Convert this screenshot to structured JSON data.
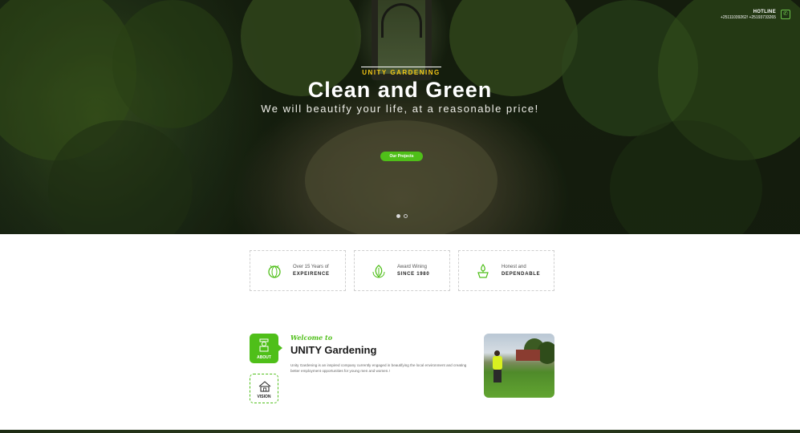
{
  "hero": {
    "kicker": "UNITY GARDENING",
    "title": "Clean and Green",
    "subtitle": "We will beautify your life, at a reasonable price!",
    "cta_label": "Our Projects",
    "slides": 2,
    "active_slide": 1
  },
  "hotline": {
    "label": "HOTLINE",
    "numbers": "+25111039262! +25193733265"
  },
  "features": [
    {
      "icon": "cabbage-icon",
      "top": "Over 15 Years of",
      "bottom": "EXPEIRENCE"
    },
    {
      "icon": "award-leaf-icon",
      "top": "Award Wining",
      "bottom": "SINCE 1980"
    },
    {
      "icon": "watering-icon",
      "top": "Honest and",
      "bottom": "DEPENDABLE"
    }
  ],
  "about": {
    "tabs": [
      {
        "label": "ABOUT",
        "icon": "gardener-icon",
        "active": true
      },
      {
        "label": "VISION",
        "icon": "garden-house-icon",
        "active": false
      }
    ],
    "welcome": "Welcome to",
    "title": "UNITY Gardening",
    "body": "Unity Gardening is an inspired company currently engaged in beautifying the local environment and creating better employment opportunities for young men and women.!"
  },
  "colors": {
    "accent": "#4fbf19",
    "kicker": "#f2c516"
  }
}
